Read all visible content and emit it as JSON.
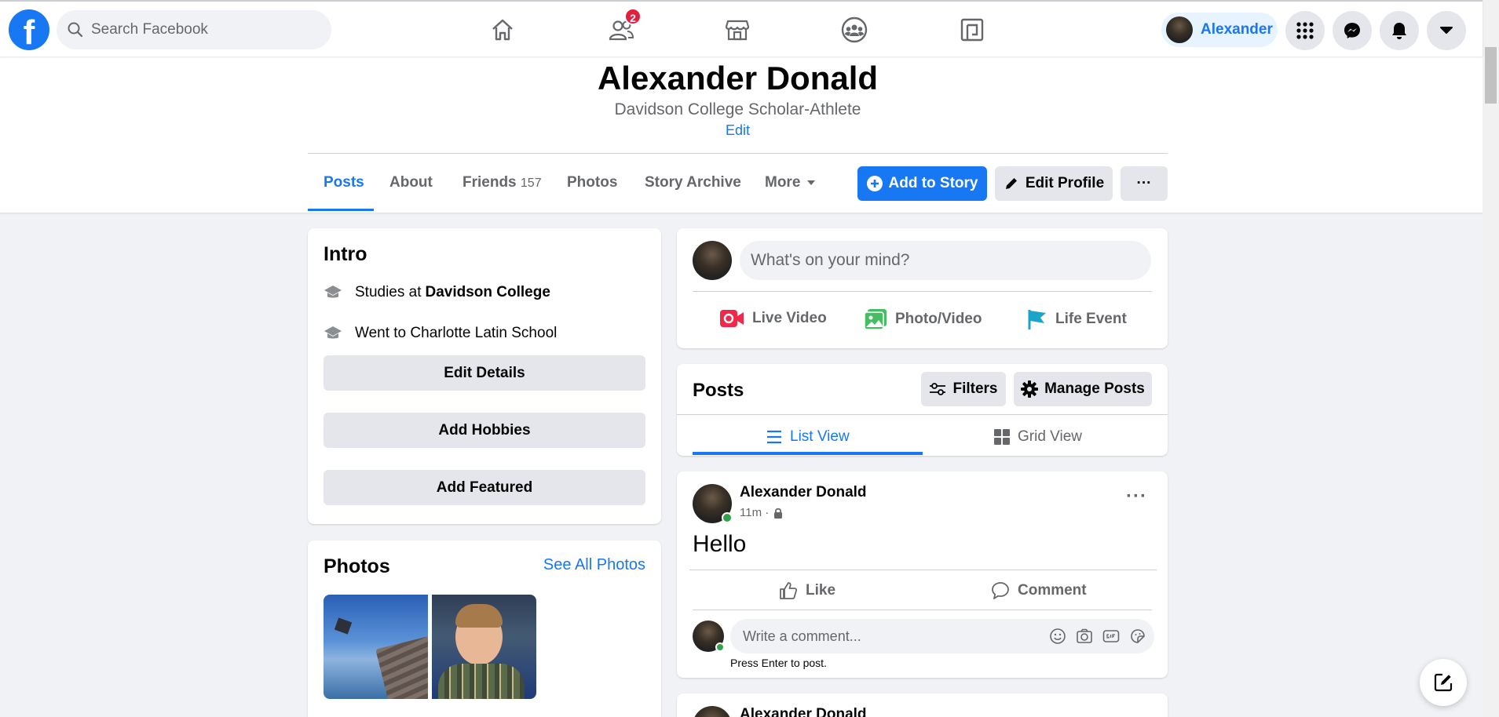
{
  "topbar": {
    "logo": "f",
    "search_placeholder": "Search Facebook",
    "friends_badge": "2",
    "profile_name": "Alexander"
  },
  "profile": {
    "name": "Alexander Donald",
    "bio": "Davidson College Scholar-Athlete",
    "edit_label": "Edit"
  },
  "tabs": [
    {
      "label": "Posts"
    },
    {
      "label": "About"
    },
    {
      "label": "Friends",
      "count": "157"
    },
    {
      "label": "Photos"
    },
    {
      "label": "Story Archive"
    },
    {
      "label": "More"
    }
  ],
  "actions": {
    "add_story": "Add to Story",
    "edit_profile": "Edit Profile",
    "more": "···"
  },
  "intro": {
    "title": "Intro",
    "studies_prefix": "Studies at ",
    "studies_school": "Davidson College",
    "went_to": "Went to Charlotte Latin School",
    "edit_details": "Edit Details",
    "add_hobbies": "Add Hobbies",
    "add_featured": "Add Featured"
  },
  "photos": {
    "title": "Photos",
    "see_all": "See All Photos"
  },
  "composer": {
    "placeholder": "What's on your mind?",
    "live_video": "Live Video",
    "photo_video": "Photo/Video",
    "life_event": "Life Event"
  },
  "posts_header": {
    "title": "Posts",
    "filters": "Filters",
    "manage": "Manage Posts",
    "list_view": "List View",
    "grid_view": "Grid View"
  },
  "post": {
    "author": "Alexander Donald",
    "time": "11m ·",
    "text": "Hello",
    "like": "Like",
    "comment": "Comment",
    "comment_placeholder": "Write a comment...",
    "hint": "Press Enter to post."
  },
  "next_post": {
    "author": "Alexander Donald"
  },
  "colors": {
    "brand": "#1877f2",
    "badge": "#e41e3f",
    "online": "#31a24c"
  }
}
